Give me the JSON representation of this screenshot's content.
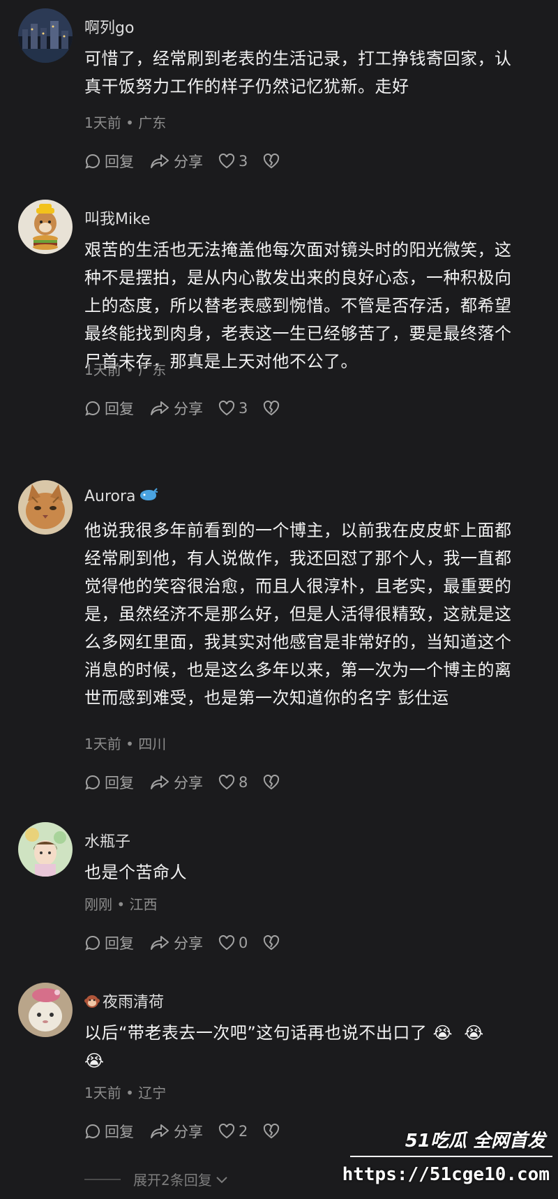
{
  "comments": [
    {
      "name": "啊列go",
      "text": "可惜了，经常刷到老表的生活记录，打工挣钱寄回家，认\n真干饭努力工作的样子仍然记忆犹新。走好",
      "meta": "1天前 • 广东",
      "reply_label": "回复",
      "share_label": "分享",
      "likes": "3",
      "avatar": "city-night-avatar"
    },
    {
      "name": "叫我Mike",
      "text": "艰苦的生活也无法掩盖他每次面对镜头时的阳光微笑，这\n种不是摆拍，是从内心散发出来的良好心态，一种积极向\n上的态度，所以替老表感到惋惜。不管是否存活，都希望\n最终能找到肉身，老表这一生已经够苦了，要是最终落个\n尸首未存，那真是上天对他不公了。",
      "meta": "1天前 • 广东",
      "reply_label": "回复",
      "share_label": "分享",
      "likes": "3",
      "avatar": "dog-burger-avatar"
    },
    {
      "name": "Aurora",
      "text": "他说我很多年前看到的一个博主，以前我在皮皮虾上面都\n经常刷到他，有人说做作，我还回怼了那个人，我一直都\n觉得他的笑容很治愈，而且人很淳朴，且老实，最重要的\n是，虽然经济不是那么好，但是人活得很精致，这就是这\n么多网红里面，我其实对他感官是非常好的，当知道这个\n消息的时候，也是这么多年以来，第一次为一个博主的离\n世而感到难受，也是第一次知道你的名字 彭仕运",
      "meta": "1天前 • 四川",
      "reply_label": "回复",
      "share_label": "分享",
      "likes": "8",
      "avatar": "cat-avatar",
      "badge": "whale-icon"
    },
    {
      "name": "水瓶子",
      "text": "也是个苦命人",
      "meta": "刚刚 • 江西",
      "reply_label": "回复",
      "share_label": "分享",
      "likes": "0",
      "avatar": "girl-avatar"
    },
    {
      "name": "夜雨清荷",
      "text": "以后“带老表去一次吧”这句话再也说不出口了 😭  😭\n😭",
      "meta": "1天前 • 辽宁",
      "reply_label": "回复",
      "share_label": "分享",
      "likes": "2",
      "avatar": "cat-hat-avatar",
      "badge_pre": "monkey-icon"
    }
  ],
  "expand_label": "展开2条回复",
  "watermark": {
    "brand": "51吃瓜 全网首发",
    "url": "https://51cge10.com"
  },
  "colors": {
    "background": "#1b1b1d",
    "text": "#f2f2f2",
    "meta": "#8d8d8d",
    "action": "#a3a3a3"
  }
}
